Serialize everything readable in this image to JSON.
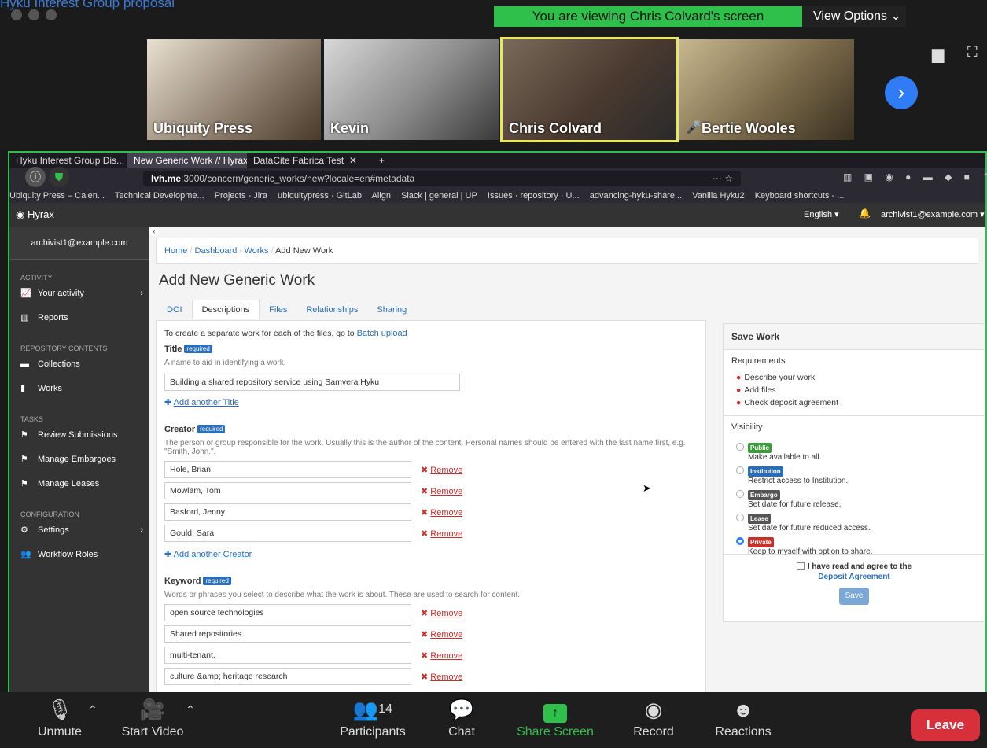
{
  "zoom": {
    "top_link": "Hyku Interest Group proposal",
    "banner": "You are viewing Chris Colvard's screen",
    "view_options": "View Options ⌄",
    "participants": [
      {
        "name": "Ubiquity Press"
      },
      {
        "name": "Kevin"
      },
      {
        "name": "Chris Colvard"
      },
      {
        "name": "Bertie Wooles"
      }
    ],
    "controls": {
      "unmute": "Unmute",
      "start_video": "Start Video",
      "participants_label": "Participants",
      "participants_count": "14",
      "chat": "Chat",
      "share_screen": "Share Screen",
      "record": "Record",
      "reactions": "Reactions",
      "leave": "Leave"
    }
  },
  "browser": {
    "tabs": [
      {
        "label": "Hyku Interest Group Dis..."
      },
      {
        "label": "New Generic Work // Hyrax"
      },
      {
        "label": "DataCite Fabrica Test"
      }
    ],
    "url_host": "lvh.me",
    "url_path": ":3000/concern/generic_works/new?locale=en#metadata",
    "bookmarks": [
      "Ubiquity Press – Calen...",
      "Technical Developme...",
      "Projects - Jira",
      "ubiquitypress · GitLab",
      "Align",
      "Slack | general | UP",
      "Issues · repository · U...",
      "advancing-hyku-share...",
      "Vanilla Hyku2",
      "Keyboard shortcuts - ..."
    ]
  },
  "hyrax": {
    "brand": "Hyrax",
    "language": "English ▾",
    "user": "archivist1@example.com ▾",
    "sidebar_user": "archivist1@example.com",
    "sections": {
      "activity": "ACTIVITY",
      "repo": "REPOSITORY CONTENTS",
      "tasks": "TASKS",
      "config": "CONFIGURATION"
    },
    "items": {
      "your_activity": "Your activity",
      "reports": "Reports",
      "collections": "Collections",
      "works": "Works",
      "review": "Review Submissions",
      "embargoes": "Manage Embargoes",
      "leases": "Manage Leases",
      "settings": "Settings",
      "workflow": "Workflow Roles"
    },
    "breadcrumb": {
      "home": "Home",
      "dashboard": "Dashboard",
      "works": "Works",
      "current": "Add New Work"
    },
    "title": "Add New Generic Work",
    "form_tabs": [
      "DOI",
      "Descriptions",
      "Files",
      "Relationships",
      "Sharing"
    ],
    "batch_text": "To create a separate work for each of the files, go to",
    "batch_link": "Batch upload",
    "required": "required",
    "remove": "Remove",
    "title_field": {
      "label": "Title",
      "help": "A name to aid in identifying a work.",
      "value": "Building a shared repository service using Samvera Hyku",
      "add": "Add another Title"
    },
    "creator_field": {
      "label": "Creator",
      "help": "The person or group responsible for the work. Usually this is the author of the content. Personal names should be entered with the last name first, e.g. \"Smith, John.\".",
      "values": [
        "Hole, Brian",
        "Mowlam, Tom",
        "Basford, Jenny",
        "Gould, Sara"
      ],
      "add": "Add another Creator"
    },
    "keyword_field": {
      "label": "Keyword",
      "help": "Words or phrases you select to describe what the work is about. These are used to search for content.",
      "values": [
        "open source technologies",
        "Shared repositories",
        "multi-tenant.",
        "culture &amp; heritage research"
      ]
    },
    "save_panel": {
      "title": "Save Work",
      "requirements": "Requirements",
      "reqs": [
        "Describe your work",
        "Add files",
        "Check deposit agreement"
      ],
      "visibility": "Visibility",
      "options": [
        {
          "badge": "Public",
          "desc": "Make available to all.",
          "color": "#3c9b3c"
        },
        {
          "badge": "Institution",
          "desc": "Restrict access to Institution.",
          "color": "#2a6ebb"
        },
        {
          "badge": "Embargo",
          "desc": "Set date for future release.",
          "color": "#555555"
        },
        {
          "badge": "Lease",
          "desc": "Set date for future reduced access.",
          "color": "#555555"
        },
        {
          "badge": "Private",
          "desc": "Keep to myself with option to share.",
          "color": "#c9302c"
        }
      ],
      "agree": "I have read and agree to the",
      "agreement_link": "Deposit Agreement",
      "save": "Save"
    }
  }
}
